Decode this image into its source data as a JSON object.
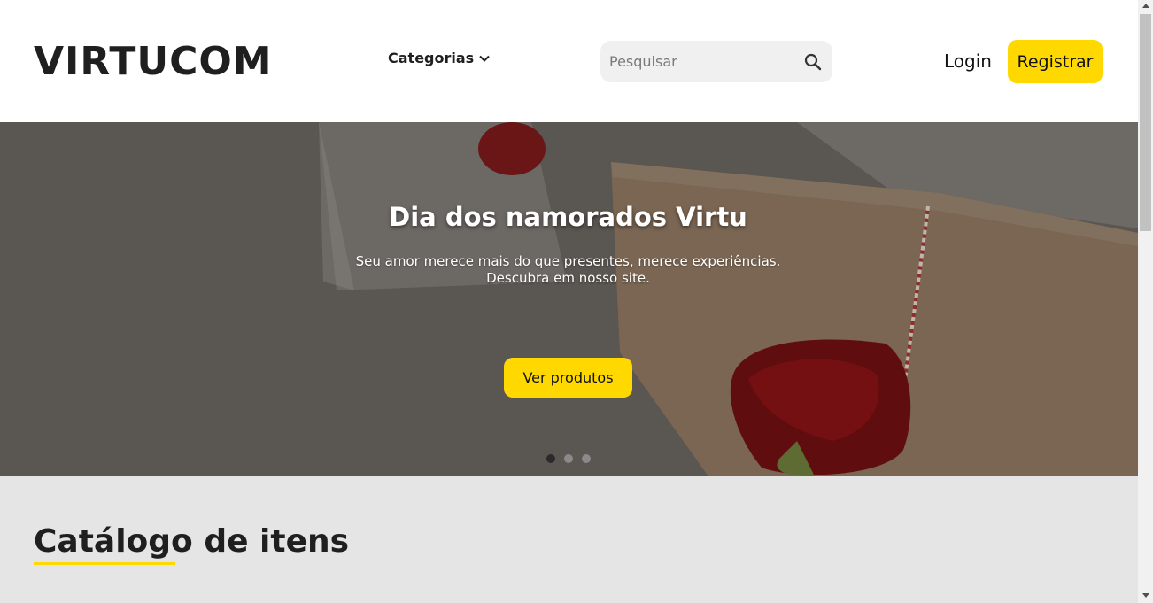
{
  "header": {
    "logo": "VIRTUCOM",
    "categories_label": "Categorias",
    "search_placeholder": "Pesquisar",
    "login_label": "Login",
    "register_label": "Registrar"
  },
  "hero": {
    "title": "Dia dos namorados Virtu",
    "subtitle_line1": "Seu amor merece mais do que presentes, merece experiências.",
    "subtitle_line2": "Descubra em nosso site.",
    "cta_label": "Ver produtos",
    "slides_total": 3,
    "active_slide": 1
  },
  "catalog": {
    "title": "Catálogo de itens"
  },
  "colors": {
    "accent": "#ffd800",
    "text": "#1f1f1f",
    "page_bg": "#e5e5e5"
  },
  "icons": {
    "categories_chevron": "chevron-down-icon",
    "search": "search-icon"
  }
}
